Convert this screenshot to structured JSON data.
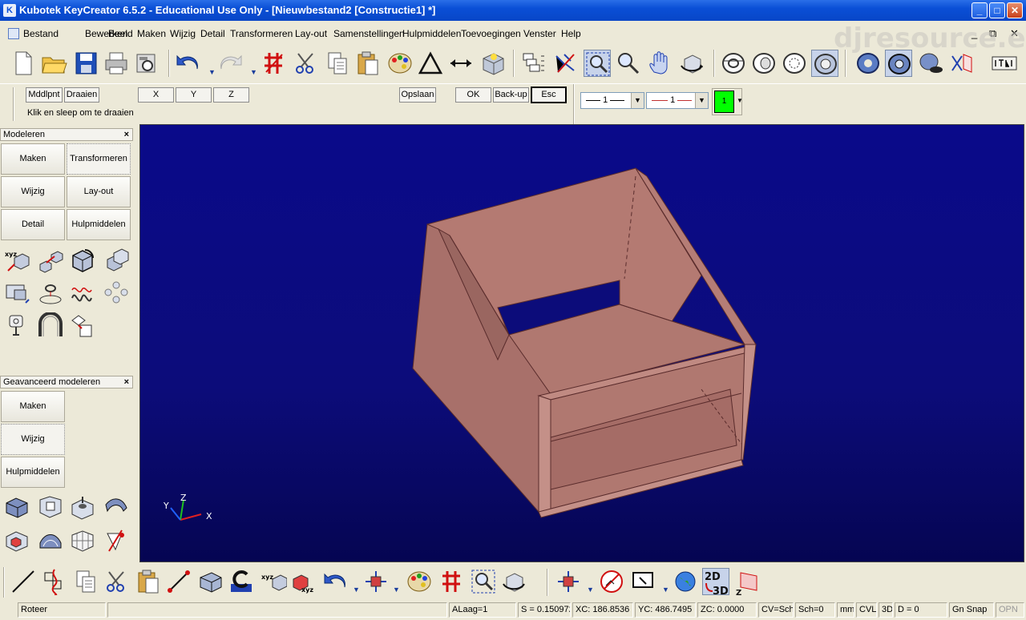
{
  "window": {
    "title": "Kubotek KeyCreator 6.5.2 - Educational Use Only - [Nieuwbestand2 [Constructie1] *]",
    "minimize": "_",
    "maximize": "□",
    "close": "✕"
  },
  "menubar": {
    "items": [
      "Bestand",
      "Bewerken",
      "Beeld",
      "Maken",
      "Wijzig",
      "Detail",
      "Transformeren",
      "Lay-out",
      "Samenstellingen",
      "Hulpmiddelen",
      "Toevoegingen",
      "Venster",
      "Help"
    ],
    "mdi_min": "_",
    "mdi_restore": "⧉",
    "mdi_close": "✕"
  },
  "watermark": "djresource.eu",
  "prompt": {
    "buttons": [
      "Mddlpnt",
      "Draaien"
    ],
    "axis_buttons": [
      "X",
      "Y",
      "Z"
    ],
    "opslaan": "Opslaan",
    "ok": "OK",
    "backup": "Back-up",
    "esc": "Esc",
    "message": "Klik en sleep om te draaien"
  },
  "attributes": {
    "line_type_value": "1",
    "line_width_value": "1",
    "color_value": "1",
    "color_hex": "#00ff00",
    "combo_arrow": "▼"
  },
  "panel_modeleren": {
    "title": "Modeleren",
    "close": "×",
    "buttons": [
      "Maken",
      "Transformeren",
      "Wijzig",
      "Lay-out",
      "Detail",
      "Hulpmiddelen"
    ]
  },
  "panel_geavanceerd": {
    "title": "Geavanceerd modeleren",
    "close": "×",
    "buttons": [
      "Maken",
      "Wijzig",
      "Hulpmiddelen"
    ]
  },
  "viewport": {
    "background": "#0a0a8a",
    "model_color": "#b07070",
    "axis_labels": {
      "x": "X",
      "y": "Y",
      "z": "Z"
    }
  },
  "statusbar": {
    "mode": "Roteer",
    "layer": "ALaag=1",
    "scale": "S = 0.150972",
    "xc": "XC: 186.8536",
    "yc": "YC: 486.7495",
    "zc": "ZC: 0.0000",
    "cv": "CV=Sch",
    "sch": "Sch=0",
    "units": "mm",
    "cvl": "CVL",
    "dim": "3D",
    "depth": "D = 0",
    "snap": "Gn Snap",
    "opn": "OPN"
  }
}
